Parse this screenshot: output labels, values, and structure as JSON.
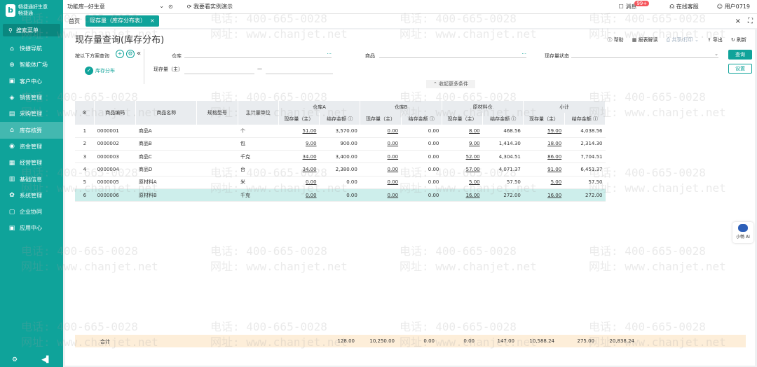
{
  "app": {
    "logo_text_1": "畅捷通好生意",
    "logo_text_2": "畅捷通"
  },
  "sidebar": {
    "search": "搜索菜单",
    "items": [
      {
        "label": "快捷导航",
        "icon": "home-icon",
        "glyph": "⌂"
      },
      {
        "label": "智能体广场",
        "icon": "robot-icon",
        "glyph": "⊕"
      },
      {
        "label": "客户中心",
        "icon": "customer-icon",
        "glyph": "▣"
      },
      {
        "label": "销售管理",
        "icon": "sales-icon",
        "glyph": "◈"
      },
      {
        "label": "采购管理",
        "icon": "purchase-icon",
        "glyph": "▤"
      },
      {
        "label": "库存核算",
        "icon": "inventory-icon",
        "glyph": "⌂"
      },
      {
        "label": "资金管理",
        "icon": "fund-icon",
        "glyph": "◉"
      },
      {
        "label": "经营管理",
        "icon": "business-icon",
        "glyph": "▦"
      },
      {
        "label": "基础信息",
        "icon": "basic-info-icon",
        "glyph": "▥"
      },
      {
        "label": "系统管理",
        "icon": "system-icon",
        "glyph": "✿"
      },
      {
        "label": "企业协同",
        "icon": "cooperation-icon",
        "glyph": "▢"
      },
      {
        "label": "应用中心",
        "icon": "app-center-icon",
        "glyph": "▣"
      }
    ],
    "active": 5
  },
  "topbar": {
    "function_lib": "功能库--好生意",
    "demo": "我要看实例演示",
    "messages": "消息",
    "badge": "99+",
    "service": "在线客服",
    "user": "用户0719"
  },
  "tabs": {
    "home": "首页",
    "active": "现存量（库存分布表）"
  },
  "page": {
    "title": "现存量查询(库存分布)",
    "toolbar": [
      "帮助",
      "报表解读",
      "共享/打印",
      "导出",
      "刷新"
    ]
  },
  "filter": {
    "scheme_label": "按以下方案查询",
    "scheme_item": "库存分布",
    "warehouse": "仓库",
    "product": "商品",
    "status": "现存量状态",
    "qty": "现存量（主）",
    "dash": "—",
    "dots": "···",
    "query": "查询",
    "settings": "设置",
    "collapse": "收起更多条件"
  },
  "table": {
    "headers": {
      "code": "商品编码",
      "name": "商品名称",
      "spec": "规格型号",
      "unit": "主计量单位",
      "groups": [
        "仓库A",
        "仓库B",
        "原材料仓",
        "小计"
      ],
      "qty": "现存量（主）",
      "amount": "结存金额"
    },
    "rows": [
      {
        "n": "1",
        "code": "0000001",
        "name": "商品A",
        "unit": "个",
        "v": [
          "51.00",
          "3,570.00",
          "0.00",
          "0.00",
          "8.00",
          "468.56",
          "59.00",
          "4,038.56"
        ]
      },
      {
        "n": "2",
        "code": "0000002",
        "name": "商品B",
        "unit": "包",
        "v": [
          "9.00",
          "900.00",
          "0.00",
          "0.00",
          "9.00",
          "1,414.30",
          "18.00",
          "2,314.30"
        ]
      },
      {
        "n": "3",
        "code": "0000003",
        "name": "商品C",
        "unit": "千克",
        "v": [
          "34.00",
          "3,400.00",
          "0.00",
          "0.00",
          "52.00",
          "4,304.51",
          "86.00",
          "7,704.51"
        ]
      },
      {
        "n": "4",
        "code": "0000004",
        "name": "商品D",
        "unit": "台",
        "v": [
          "34.00",
          "2,380.00",
          "0.00",
          "0.00",
          "57.00",
          "4,071.37",
          "91.00",
          "6,451.37"
        ]
      },
      {
        "n": "5",
        "code": "0000005",
        "name": "原材料A",
        "unit": "米",
        "v": [
          "0.00",
          "0.00",
          "0.00",
          "0.00",
          "5.00",
          "57.50",
          "5.00",
          "57.50"
        ]
      },
      {
        "n": "6",
        "code": "0000006",
        "name": "原材料B",
        "unit": "千克",
        "v": [
          "0.00",
          "0.00",
          "0.00",
          "0.00",
          "16.00",
          "272.00",
          "16.00",
          "272.00"
        ]
      }
    ],
    "total": {
      "label": "合计",
      "v": [
        "128.00",
        "10,250.00",
        "0.00",
        "0.00",
        "147.00",
        "10,588.24",
        "275.00",
        "20,838.24"
      ]
    }
  },
  "watermark": {
    "phone": "电话: 400-665-0028",
    "site": "网址: www.chanjet.net"
  },
  "helper": {
    "label": "小畅 AI"
  }
}
